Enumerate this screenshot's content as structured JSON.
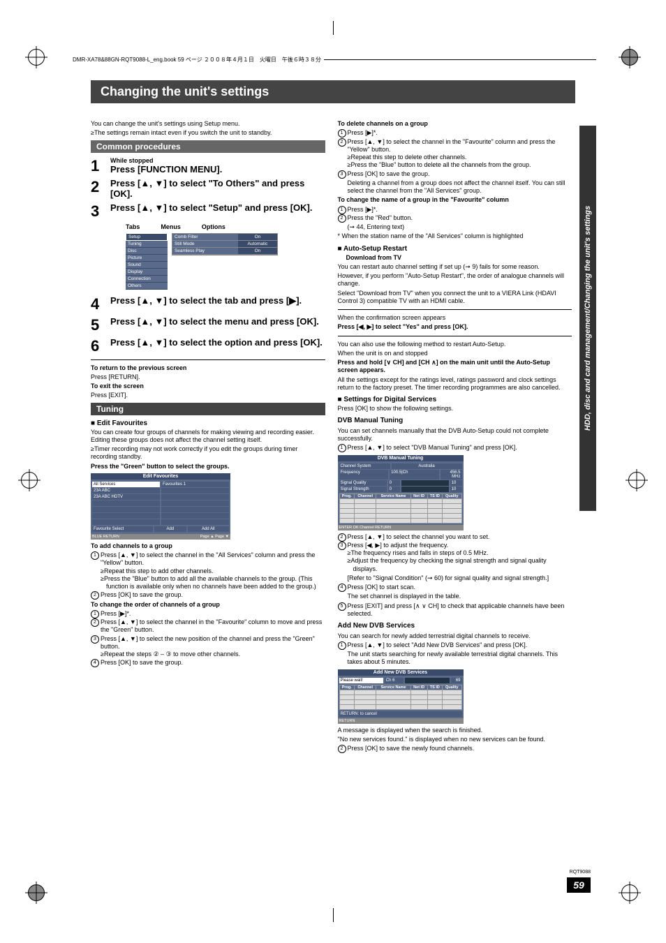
{
  "header": "DMR-XA78&88GN-RQT9088-L_eng.book  59 ページ  ２００８年４月１日　火曜日　午後６時３８分",
  "title": "Changing the unit's settings",
  "side_tab": "HDD, disc and card management/Changing the unit's settings",
  "intro_line1": "You can change the unit's settings using Setup menu.",
  "intro_line2": "≥The settings remain intact even if you switch the unit to standby.",
  "doc_id": "RQT9088",
  "page_number": "59",
  "common": {
    "bar": "Common procedures",
    "steps": [
      {
        "small": "While stopped",
        "big": "Press [FUNCTION MENU]."
      },
      {
        "big": "Press [▲, ▼] to select \"To Others\" and press [OK]."
      },
      {
        "big": "Press [▲, ▼] to select \"Setup\" and press [OK]."
      },
      {
        "big": "Press [▲, ▼] to select the tab and press [▶]."
      },
      {
        "big": "Press [▲, ▼] to select the menu and press [OK]."
      },
      {
        "big": "Press [▲, ▼] to select the option and press [OK]."
      }
    ],
    "labels": [
      "Tabs",
      "Menus",
      "Options"
    ],
    "setup_tabs": [
      "Setup",
      "Tuning",
      "Disc",
      "Picture",
      "Sound",
      "Display",
      "Connection",
      "Others"
    ],
    "setup_menu": [
      {
        "name": "Comb Filter",
        "val": "On"
      },
      {
        "name": "Still Mode",
        "val": "Automatic"
      },
      {
        "name": "Seamless Play",
        "val": "On"
      }
    ],
    "return_head": "To return to the previous screen",
    "return_body": "Press [RETURN].",
    "exit_head": "To exit the screen",
    "exit_body": "Press [EXIT]."
  },
  "tuning": {
    "bar": "Tuning",
    "edit_head": "■ Edit Favourites",
    "edit_p1": "You can create four groups of channels for making viewing and recording easier. Editing these groups does not affect the channel setting itself.",
    "edit_b1": "≥Timer recording may not work correctly if you edit the groups during timer recording standby.",
    "edit_green": "Press the \"Green\" button to select the groups.",
    "edit_ss": {
      "title": "Edit Favourites",
      "left_head": "All Services",
      "right_head": "Favourites 1",
      "rows": [
        "23A ABC",
        "23A ABC HDTV"
      ],
      "foot_left": "Favourite Select",
      "foot_mid": "Add",
      "foot_right": "Add All",
      "bottom_left": "BLUE   RETURN",
      "bottom_right": "Page ▲  Page ▼"
    },
    "add_head": "To add channels to a group",
    "add_steps": {
      "s1": "Press [▲, ▼] to select the channel in the \"All Services\" column and press the \"Yellow\" button.",
      "s1b1": "≥Repeat this step to add other channels.",
      "s1b2": "≥Press the \"Blue\" button to add all the available channels to the group. (This function is available only when no channels have been added to the group.)",
      "s2": "Press [OK] to save the group."
    },
    "order_head": "To change the order of channels of a group",
    "order_steps": {
      "s1": "Press [▶]*.",
      "s2": "Press [▲, ▼] to select the channel in the \"Favourite\" column to move and press the \"Green\" button.",
      "s3": "Press [▲, ▼] to select the new position of the channel and press the \"Green\" button.",
      "s3b": "≥Repeat the steps ② – ③ to move other channels.",
      "s4": "Press [OK] to save the group."
    }
  },
  "right": {
    "del_head": "To delete channels on a group",
    "del": {
      "s1": "Press [▶]*.",
      "s2": "Press [▲, ▼] to select the channel in the \"Favourite\" column and press the \"Yellow\" button.",
      "s2b1": "≥Repeat this step to delete other channels.",
      "s2b2": "≥Press the \"Blue\" button to delete all the channels from the group.",
      "s3": "Press [OK] to save the group.",
      "s3n": "Deleting a channel from a group does not affect the channel itself. You can still select the channel from the \"All Services\" group."
    },
    "rename_head": "To change the name of a group in the \"Favourite\" column",
    "rename": {
      "s1": "Press [▶]*.",
      "s2": "Press the \"Red\" button.",
      "s2n": "(➞ 44, Entering text)"
    },
    "star_note": "* When the station name of the \"All Services\" column is highlighted",
    "auto_head": "■ Auto-Setup Restart",
    "auto_head2": "Download from TV",
    "auto_p1": "You can restart auto channel setting if set up (➞ 9) fails for some reason.",
    "auto_p2": "However, if you perform \"Auto-Setup Restart\", the order of analogue channels will change.",
    "auto_p3": "Select \"Download from TV\" when you connect the unit to a VIERA Link (HDAVI Control 3) compatible TV with an HDMI cable.",
    "auto_conf_head": "When the confirmation screen appears",
    "auto_conf_body": "Press [◀, ▶] to select \"Yes\" and press [OK].",
    "auto_alt_p1": "You can also use the following method to restart Auto-Setup.",
    "auto_alt_p2": "When the unit is on and stopped",
    "auto_alt_bold": "Press and hold [∨ CH] and [CH ∧] on the main unit until the Auto-Setup screen appears.",
    "auto_alt_p3": "All the settings except for the ratings level, ratings password and clock settings return to the factory preset. The timer recording programmes are also cancelled.",
    "digi_head": "■ Settings for Digital Services",
    "digi_p1": "Press [OK] to show the following settings.",
    "dvb_head": "DVB Manual Tuning",
    "dvb_p1": "You can set channels manually that the DVB Auto-Setup could not complete successfully.",
    "dvb_steps": {
      "s1": "Press [▲, ▼] to select \"DVB Manual Tuning\" and press [OK].",
      "s2": "Press [▲, ▼] to select the channel you want to set.",
      "s3": "Press [◀, ▶] to adjust the frequency.",
      "s3b1": "≥The frequency rises and falls in steps of 0.5 MHz.",
      "s3b2": "≥Adjust the frequency by checking the signal strength and signal quality displays.",
      "s3b3": "[Refer to \"Signal Condition\" (➞ 60) for signal quality and signal strength.]",
      "s4": "Press [OK] to start scan.",
      "s4n": "The set channel is displayed in the table.",
      "s5": "Press [EXIT] and press [∧ ∨ CH] to check that applicable channels have been selected."
    },
    "dvb_ss": {
      "title": "DVB Manual Tuning",
      "rows": [
        [
          "Channel System",
          "Australia"
        ],
        [
          "Frequency",
          "100.5|Ch",
          "456.5 MHz"
        ],
        [
          "Signal Quality",
          "0",
          "10"
        ],
        [
          "Signal Strength",
          "0",
          "10"
        ]
      ],
      "th": [
        "Prog.",
        "Channel",
        "Service Name",
        "Net ID",
        "TS ID",
        "Quality"
      ],
      "foot": "ENTER OK  Channel   RETURN"
    },
    "adddvb_head": "Add New DVB Services",
    "adddvb_p1": "You can search for newly added terrestrial digital channels to receive.",
    "adddvb_steps": {
      "s1": "Press [▲, ▼] to select \"Add New DVB Services\" and press [OK].",
      "s1n": "The unit starts searching for newly available terrestrial digital channels. This takes about 5 minutes.",
      "after1": "A message is displayed when the search is finished.",
      "after2": "\"No new services found.\" is displayed when no new services can be found.",
      "s2": "Press [OK] to save the newly found channels."
    },
    "adddvb_ss": {
      "title": "Add New DVB Services",
      "wait": "Please wait!",
      "ch": "Ch 6",
      "th": [
        "Prog.",
        "Channel",
        "Service Name",
        "Net ID",
        "TS ID",
        "Quality"
      ],
      "ret": "RETURN: to cancel",
      "foot": "RETURN"
    }
  }
}
